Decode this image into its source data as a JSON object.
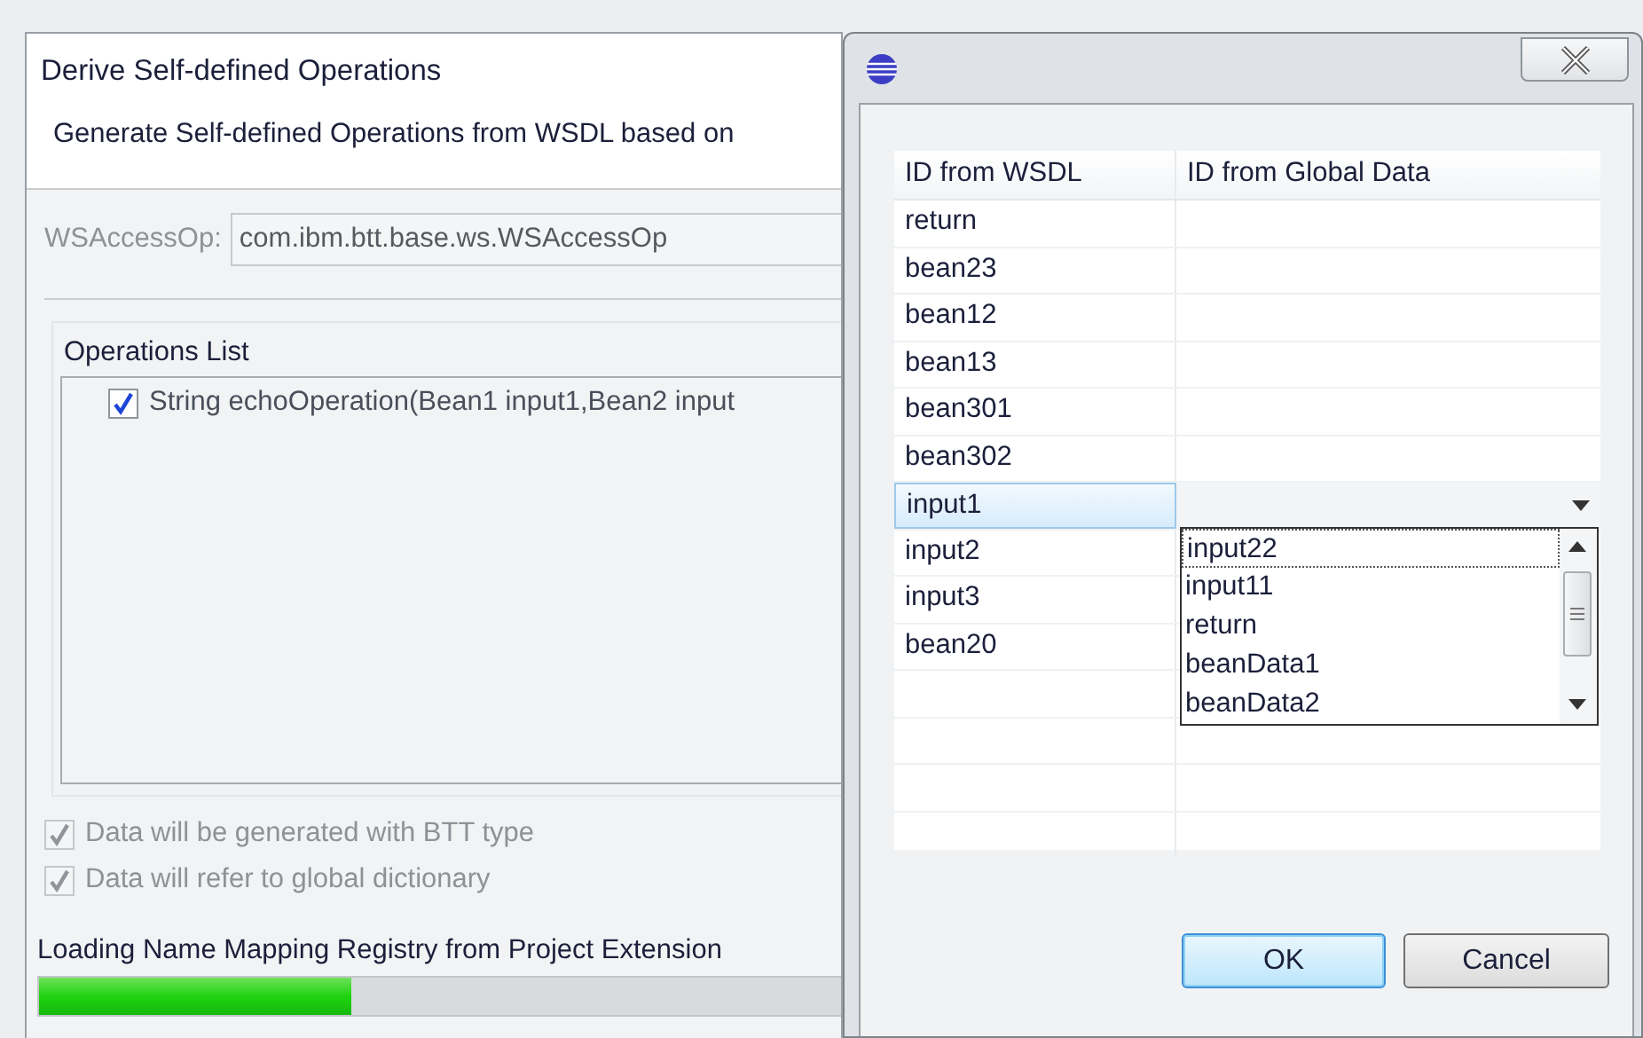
{
  "background_dialog": {
    "title": "Derive Self-defined Operations",
    "description": "Generate Self-defined Operations from WSDL based on",
    "access_op": {
      "label": "WSAccessOp:",
      "value": "com.ibm.btt.base.ws.WSAccessOp",
      "disabled": true
    },
    "operations_list": {
      "title": "Operations List",
      "items": [
        {
          "label": "String echoOperation(Bean1 input1,Bean2 input",
          "checked": true
        }
      ]
    },
    "options": [
      {
        "label": "Data will be generated with BTT type",
        "checked": true,
        "disabled": true
      },
      {
        "label": "Data will refer to global dictionary",
        "checked": true,
        "disabled": true
      }
    ],
    "status": "Loading Name Mapping Registry from Project Extension",
    "progress": {
      "level": 0.39
    }
  },
  "mapping_dialog": {
    "table": {
      "columns": [
        "ID from WSDL",
        "ID from Global Data"
      ],
      "rows": [
        {
          "wsdl_id": "return",
          "selected": false
        },
        {
          "wsdl_id": "bean23",
          "selected": false
        },
        {
          "wsdl_id": "bean12",
          "selected": false
        },
        {
          "wsdl_id": "bean13",
          "selected": false
        },
        {
          "wsdl_id": "bean301",
          "selected": false
        },
        {
          "wsdl_id": "bean302",
          "selected": false
        },
        {
          "wsdl_id": "input1",
          "selected": true
        },
        {
          "wsdl_id": "input2",
          "selected": false
        },
        {
          "wsdl_id": "input3",
          "selected": false
        },
        {
          "wsdl_id": "bean20",
          "selected": false
        }
      ]
    },
    "dropdown": {
      "items": [
        {
          "label": "input22",
          "selected": true
        },
        {
          "label": "input11",
          "selected": false
        },
        {
          "label": "return",
          "selected": false
        },
        {
          "label": "beanData1",
          "selected": false
        },
        {
          "label": "beanData2",
          "selected": false
        }
      ]
    },
    "buttons": [
      {
        "label": "OK",
        "default": true
      },
      {
        "label": "Cancel",
        "default": false
      }
    ]
  }
}
